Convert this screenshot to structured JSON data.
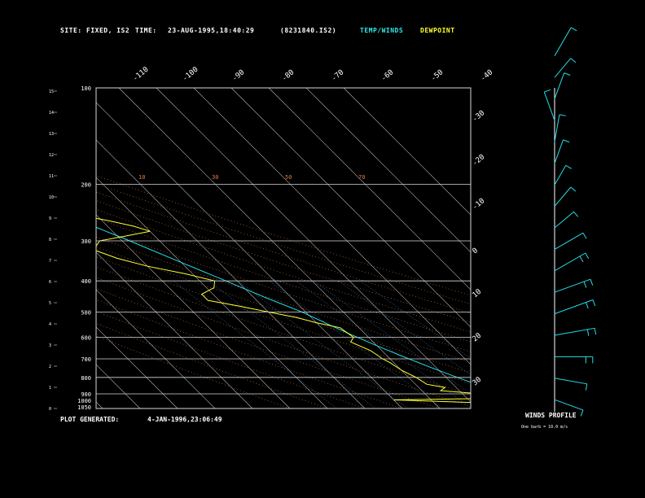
{
  "header": {
    "site_label": "SITE:",
    "site_value": "FIXED, IS2",
    "time_label": "TIME:",
    "time_value": "23-AUG-1995,18:40:29",
    "file_id": "(8231840.IS2)",
    "legend_temp": "TEMP/WINDS",
    "legend_dew": "DEWPOINT"
  },
  "footer": {
    "generated_label": "PLOT GENERATED:",
    "generated_value": "4-JAN-1996,23:06:49"
  },
  "winds": {
    "title": "WINDS PROFILE",
    "note": "One barb = 10.0 m/s"
  },
  "colors": {
    "temp": "#22e0e6",
    "dew": "#ffff33",
    "legend_temp": "#33e6e6",
    "legend_dew": "#ffff33",
    "frame": "#d8d8d8",
    "mixing": "#3b82c8",
    "dry_adiabat": "#e07a3a"
  },
  "chart_data": {
    "type": "line",
    "pressure_levels": [
      400,
      300,
      200,
      100
    ],
    "pressure_labels": [
      "1050",
      "1000",
      "900",
      "800",
      "700",
      "600",
      "500",
      "400",
      "300",
      "200",
      "100"
    ],
    "pressure_axis_hpa": [
      1000,
      900,
      800,
      700,
      600,
      500,
      400,
      300,
      200,
      100
    ],
    "height_ticks_km": [
      "0",
      "1",
      "2",
      "3",
      "4",
      "5",
      "6",
      "7",
      "8",
      "9",
      "10",
      "11",
      "12",
      "13",
      "14",
      "15"
    ],
    "skewed_temp_labels_top": [
      "-110",
      "-100",
      "-90",
      "-80",
      "-70",
      "-60",
      "-50",
      "-40"
    ],
    "right_temp_labels": [
      "-30",
      "-20",
      "-10",
      "0",
      "10",
      "20",
      "30"
    ],
    "mixing_ratio_labels": [
      "10",
      "30",
      "50",
      "70"
    ],
    "series": [
      {
        "name": "TEMP/WINDS",
        "points": [
          {
            "p": 1000,
            "t": 29
          },
          {
            "p": 950,
            "t": 25
          },
          {
            "p": 900,
            "t": 21
          },
          {
            "p": 850,
            "t": 17
          },
          {
            "p": 800,
            "t": 13
          },
          {
            "p": 750,
            "t": 9
          },
          {
            "p": 700,
            "t": 5
          },
          {
            "p": 650,
            "t": 1
          },
          {
            "p": 600,
            "t": -3
          },
          {
            "p": 550,
            "t": -7
          },
          {
            "p": 500,
            "t": -11
          },
          {
            "p": 450,
            "t": -17
          },
          {
            "p": 400,
            "t": -23
          },
          {
            "p": 350,
            "t": -30
          },
          {
            "p": 300,
            "t": -38
          },
          {
            "p": 250,
            "t": -48
          },
          {
            "p": 200,
            "t": -58
          },
          {
            "p": 170,
            "t": -66
          },
          {
            "p": 150,
            "t": -72
          },
          {
            "p": 130,
            "t": -76
          },
          {
            "p": 115,
            "t": -75
          },
          {
            "p": 100,
            "t": -72
          }
        ]
      },
      {
        "name": "DEWPOINT",
        "points": [
          {
            "p": 1000,
            "t": 24
          },
          {
            "p": 980,
            "t": 23
          },
          {
            "p": 960,
            "t": 12
          },
          {
            "p": 940,
            "t": -10
          },
          {
            "p": 930,
            "t": 16
          },
          {
            "p": 900,
            "t": 15
          },
          {
            "p": 880,
            "t": 5
          },
          {
            "p": 860,
            "t": 7
          },
          {
            "p": 840,
            "t": 3
          },
          {
            "p": 800,
            "t": 2
          },
          {
            "p": 760,
            "t": 0
          },
          {
            "p": 720,
            "t": -1
          },
          {
            "p": 700,
            "t": -2
          },
          {
            "p": 660,
            "t": -3
          },
          {
            "p": 620,
            "t": -6
          },
          {
            "p": 600,
            "t": -4
          },
          {
            "p": 560,
            "t": -5
          },
          {
            "p": 540,
            "t": -10
          },
          {
            "p": 520,
            "t": -14
          },
          {
            "p": 500,
            "t": -20
          },
          {
            "p": 480,
            "t": -26
          },
          {
            "p": 460,
            "t": -33
          },
          {
            "p": 440,
            "t": -33
          },
          {
            "p": 420,
            "t": -28
          },
          {
            "p": 400,
            "t": -26
          },
          {
            "p": 380,
            "t": -32
          },
          {
            "p": 360,
            "t": -40
          },
          {
            "p": 340,
            "t": -46
          },
          {
            "p": 320,
            "t": -50
          },
          {
            "p": 300,
            "t": -46
          },
          {
            "p": 290,
            "t": -38
          },
          {
            "p": 280,
            "t": -30
          },
          {
            "p": 270,
            "t": -33
          },
          {
            "p": 260,
            "t": -38
          },
          {
            "p": 250,
            "t": -44
          },
          {
            "p": 240,
            "t": -52
          },
          {
            "p": 230,
            "t": -60
          },
          {
            "p": 220,
            "t": -66
          },
          {
            "p": 200,
            "t": -74
          },
          {
            "p": 180,
            "t": -80
          },
          {
            "p": 160,
            "t": -88
          },
          {
            "p": 140,
            "t": -92
          },
          {
            "p": 120,
            "t": -94
          },
          {
            "p": 100,
            "t": -96
          }
        ]
      }
    ],
    "wind_barbs": [
      {
        "z": 0.02,
        "dir": 250,
        "spd": 12
      },
      {
        "z": 0.08,
        "dir": 260,
        "spd": 14
      },
      {
        "z": 0.14,
        "dir": 270,
        "spd": 18
      },
      {
        "z": 0.2,
        "dir": 280,
        "spd": 20
      },
      {
        "z": 0.26,
        "dir": 290,
        "spd": 20
      },
      {
        "z": 0.32,
        "dir": 290,
        "spd": 18
      },
      {
        "z": 0.38,
        "dir": 300,
        "spd": 16
      },
      {
        "z": 0.44,
        "dir": 300,
        "spd": 14
      },
      {
        "z": 0.5,
        "dir": 310,
        "spd": 8
      },
      {
        "z": 0.56,
        "dir": 320,
        "spd": 8
      },
      {
        "z": 0.62,
        "dir": 330,
        "spd": 6
      },
      {
        "z": 0.68,
        "dir": 340,
        "spd": 8
      },
      {
        "z": 0.74,
        "dir": 350,
        "spd": 10
      },
      {
        "z": 0.8,
        "dir": 20,
        "spd": 12
      },
      {
        "z": 0.86,
        "dir": 340,
        "spd": 10
      },
      {
        "z": 0.92,
        "dir": 320,
        "spd": 8
      },
      {
        "z": 0.98,
        "dir": 330,
        "spd": 14
      }
    ]
  }
}
